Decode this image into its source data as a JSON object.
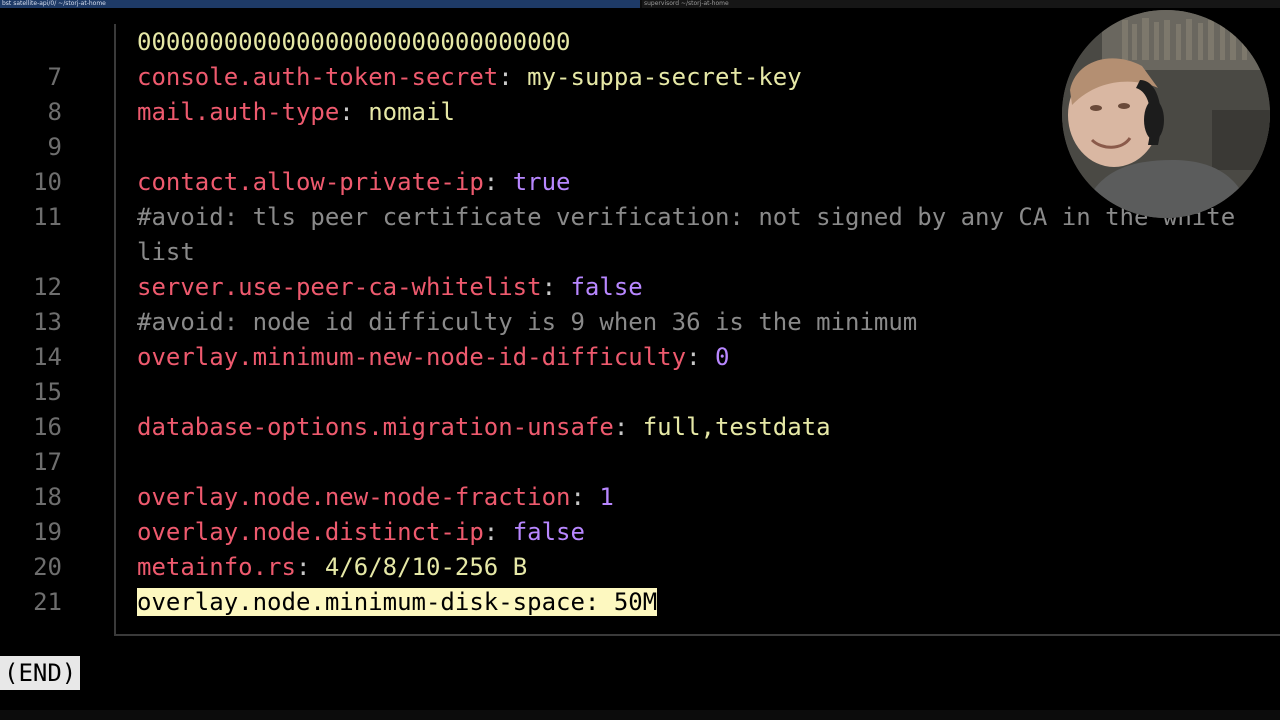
{
  "tabs": {
    "left": "bst satellite-api/0/ ~/storj-at-home",
    "right": "supervisord ~/storj-at-home"
  },
  "editor": {
    "lines": [
      {
        "num": "",
        "parts": [
          {
            "t": "s",
            "v": "000000000000000000000000000000"
          }
        ]
      },
      {
        "num": "7",
        "parts": [
          {
            "t": "k",
            "v": "console.auth-token-secret"
          },
          {
            "t": "p",
            "v": ": "
          },
          {
            "t": "s",
            "v": "my-suppa-secret-key"
          }
        ]
      },
      {
        "num": "8",
        "parts": [
          {
            "t": "k",
            "v": "mail.auth-type"
          },
          {
            "t": "p",
            "v": ": "
          },
          {
            "t": "s",
            "v": "nomail"
          }
        ]
      },
      {
        "num": "9",
        "parts": []
      },
      {
        "num": "10",
        "parts": [
          {
            "t": "k",
            "v": "contact.allow-private-ip"
          },
          {
            "t": "p",
            "v": ": "
          },
          {
            "t": "b",
            "v": "true"
          }
        ]
      },
      {
        "num": "11",
        "parts": [
          {
            "t": "c",
            "v": "#avoid: tls peer certificate verification: not signed by any CA in the white"
          }
        ]
      },
      {
        "num": "",
        "parts": [
          {
            "t": "c",
            "v": "list"
          }
        ]
      },
      {
        "num": "12",
        "parts": [
          {
            "t": "k",
            "v": "server.use-peer-ca-whitelist"
          },
          {
            "t": "p",
            "v": ": "
          },
          {
            "t": "b",
            "v": "false"
          }
        ]
      },
      {
        "num": "13",
        "parts": [
          {
            "t": "c",
            "v": "#avoid: node id difficulty is 9 when 36 is the minimum"
          }
        ]
      },
      {
        "num": "14",
        "parts": [
          {
            "t": "k",
            "v": "overlay.minimum-new-node-id-difficulty"
          },
          {
            "t": "p",
            "v": ": "
          },
          {
            "t": "b",
            "v": "0"
          }
        ]
      },
      {
        "num": "15",
        "parts": []
      },
      {
        "num": "16",
        "parts": [
          {
            "t": "k",
            "v": "database-options.migration-unsafe"
          },
          {
            "t": "p",
            "v": ": "
          },
          {
            "t": "s",
            "v": "full,testdata"
          }
        ]
      },
      {
        "num": "17",
        "parts": []
      },
      {
        "num": "18",
        "parts": [
          {
            "t": "k",
            "v": "overlay.node.new-node-fraction"
          },
          {
            "t": "p",
            "v": ": "
          },
          {
            "t": "b",
            "v": "1"
          }
        ]
      },
      {
        "num": "19",
        "parts": [
          {
            "t": "k",
            "v": "overlay.node.distinct-ip"
          },
          {
            "t": "p",
            "v": ": "
          },
          {
            "t": "b",
            "v": "false"
          }
        ]
      },
      {
        "num": "20",
        "parts": [
          {
            "t": "k",
            "v": "metainfo.rs"
          },
          {
            "t": "p",
            "v": ": "
          },
          {
            "t": "s",
            "v": "4/6/8/10-256 B"
          }
        ]
      },
      {
        "num": "21",
        "parts": [
          {
            "t": "hl",
            "v": "overlay.node.minimum-disk-space: 50M"
          }
        ]
      }
    ]
  },
  "status": {
    "end_label": "(END)"
  },
  "webcam": {
    "description": "webcam-overlay"
  }
}
